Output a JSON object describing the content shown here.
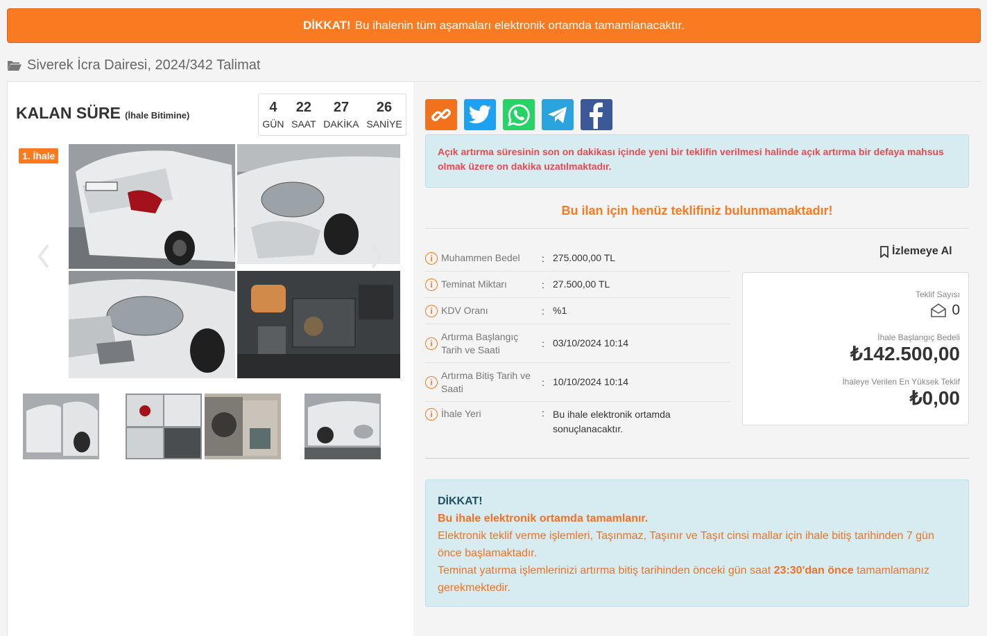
{
  "banner": {
    "strong": "DİKKAT!",
    "text": "Bu ihalenin tüm aşamaları elektronik ortamda tamamlanacaktır."
  },
  "breadcrumb": {
    "icon": "folder-open-icon",
    "text": "Siverek İcra Dairesi, 2024/342 Talimat"
  },
  "timer": {
    "title": "KALAN SÜRE",
    "subtitle": "(İhale Bitimine)",
    "cells": [
      {
        "value": "4",
        "label": "GÜN"
      },
      {
        "value": "22",
        "label": "SAAT"
      },
      {
        "value": "27",
        "label": "DAKİKA"
      },
      {
        "value": "26",
        "label": "SANİYE"
      }
    ]
  },
  "gallery": {
    "tag": "1. İhale"
  },
  "social": [
    {
      "name": "link-icon",
      "color": "#f2711c"
    },
    {
      "name": "twitter-icon",
      "color": "#1da1f2"
    },
    {
      "name": "whatsapp-icon",
      "color": "#25d366"
    },
    {
      "name": "telegram-icon",
      "color": "#2aa3df"
    },
    {
      "name": "facebook-icon",
      "color": "#3b5998"
    }
  ],
  "info_box": "Açık artırma süresinin son on dakikası içinde yeni bir teklifin verilmesi halinde açık artırma bir defaya mahsus olmak üzere on dakika uzatılmaktadır.",
  "no_bid": "Bu ilan için henüz teklifiniz bulunmamaktadır!",
  "details": [
    {
      "label": "Muhammen Bedel",
      "value": "275.000,00 TL"
    },
    {
      "label": "Teminat Miktarı",
      "value": "27.500,00 TL"
    },
    {
      "label": "KDV Oranı",
      "value": "%1"
    },
    {
      "label": "Artırma Başlangıç Tarih ve Saati",
      "value": "03/10/2024 10:14"
    },
    {
      "label": "Artırma Bitiş Tarih ve Saati",
      "value": "10/10/2024 10:14"
    },
    {
      "label": "İhale Yeri",
      "value": "Bu ihale elektronik ortamda sonuçlanacaktır."
    }
  ],
  "watch_label": "İzlemeye Al",
  "bid_box": {
    "count_label": "Teklif Sayısı",
    "count_value": "0",
    "start_label": "İhale Başlangıç Bedeli",
    "start_value": "₺142.500,00",
    "max_label": "İhaleye Verilen En Yüksek Teklif",
    "max_value": "₺0,00"
  },
  "warning": {
    "title": "DİKKAT!",
    "subtitle": "Bu ihale elektronik ortamda tamamlanır.",
    "p1": "Elektronik teklif verme işlemleri, Taşınmaz, Taşınır ve Taşıt cinsi mallar için ihale bitiş tarihinden 7 gün önce başlamaktadır.",
    "p2_pre": "Teminat yatırma işlemlerinizi artırma bitiş tarihinden önceki gün saat",
    "p2_bold": "23:30'dan önce",
    "p2_post": "tamamlamanız gerekmektedir."
  }
}
